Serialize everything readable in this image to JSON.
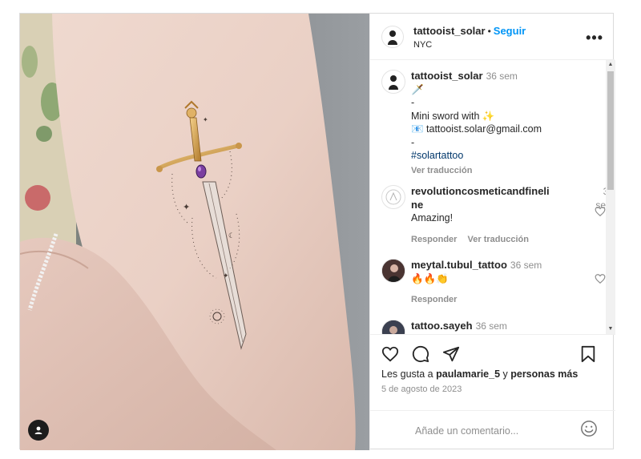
{
  "post": {
    "username": "tattooist_solar",
    "separator": "•",
    "follow_label": "Seguir",
    "location": "NYC",
    "more_label": "•••"
  },
  "caption": {
    "username": "tattooist_solar",
    "time": "36 sem",
    "line_dash1": "-",
    "line_text": "Mini sword with ✨",
    "line_email": "📧 tattooist.solar@gmail.com",
    "line_dash2": "-",
    "hashtag": "#solartattoo",
    "translate_label": "Ver traducción",
    "sword_emoji": "🗡️"
  },
  "comments": [
    {
      "username": "revolutioncosmeticandfineline",
      "username_l1": "revolutioncosmeticandfineli",
      "username_l2": "ne",
      "time_l1": "34",
      "time_l2": "sem",
      "text": "Amazing!",
      "reply_label": "Responder",
      "translate_label": "Ver traducción"
    },
    {
      "username": "meytal.tubul_tattoo",
      "time": "36 sem",
      "text": "🔥🔥👏",
      "reply_label": "Responder"
    },
    {
      "username": "tattoo.sayeh",
      "time": "36 sem"
    }
  ],
  "footer": {
    "likes_prefix": "Les gusta a ",
    "likes_user": "paulamarie_5",
    "likes_mid": " y ",
    "likes_suffix": "personas más",
    "date": "5 de agosto de 2023",
    "comment_placeholder": "Añade un comentario..."
  },
  "icons": {
    "like": "heart-icon",
    "comment": "comment-icon",
    "share": "share-icon",
    "save": "bookmark-icon",
    "emoji": "emoji-icon",
    "tagged": "user-tag-icon"
  },
  "colors": {
    "accent": "#0095f6",
    "muted": "#8e8e8e",
    "text": "#262626"
  }
}
